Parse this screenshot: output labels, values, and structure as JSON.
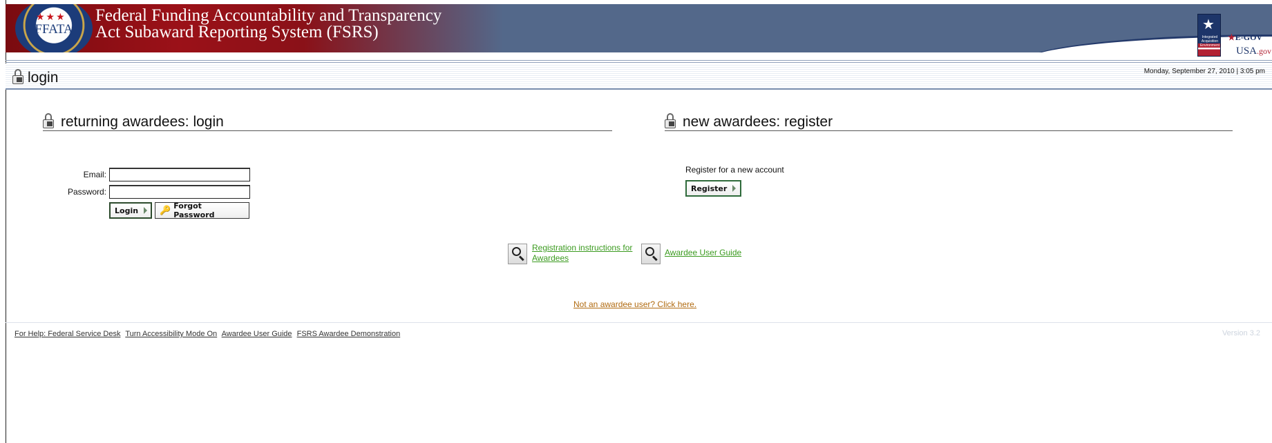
{
  "header": {
    "seal_abbr": "FFATA",
    "seal_stars": "★★★",
    "title_line1": "Federal Funding Accountability and Transparency",
    "title_line2": "Act Subaward Reporting System (FSRS)",
    "egov_logo": {
      "flag_text": "Integrated Acquisition Environment",
      "egov": "E-GOV",
      "usa": "USA",
      "usa_suffix": ".gov"
    }
  },
  "loginbar": {
    "title": "login",
    "datetime": "Monday, September 27, 2010 | 3:05 pm"
  },
  "login_section": {
    "heading": "returning awardees: login",
    "email_label": "Email:",
    "email_value": "",
    "password_label": "Password:",
    "password_value": "",
    "login_button": "Login",
    "forgot_button": "Forgot Password"
  },
  "register_section": {
    "heading": "new awardees: register",
    "description": "Register for a new account",
    "register_button": "Register"
  },
  "help_links": {
    "registration_instructions": "Registration instructions for Awardees",
    "awardee_guide": "Awardee User Guide"
  },
  "not_awardee_link": "Not an awardee user? Click here.",
  "footer": {
    "links": [
      "For Help: Federal Service Desk",
      "Turn Accessibility Mode On",
      "Awardee User Guide",
      "FSRS Awardee Demonstration"
    ],
    "version": "Version 3.2"
  },
  "colors": {
    "header_blue": "#53688a",
    "header_red": "#9b1118",
    "link_green": "#3a9a1e",
    "link_orange": "#b06a10"
  }
}
